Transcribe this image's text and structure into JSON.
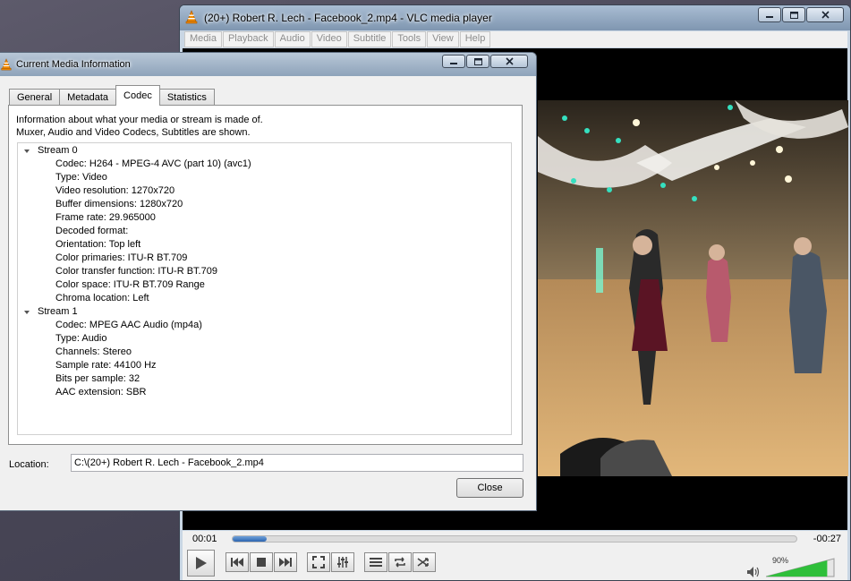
{
  "vlc": {
    "title": "(20+) Robert R. Lech - Facebook_2.mp4 - VLC media player",
    "menu": [
      "Media",
      "Playback",
      "Audio",
      "Video",
      "Subtitle",
      "Tools",
      "View",
      "Help"
    ],
    "time_elapsed": "00:01",
    "time_remaining": "-00:27",
    "seek_progress": 0.06,
    "volume_label": "90%",
    "volume_level": 0.9,
    "buttons": [
      "play",
      "previous",
      "stop",
      "next",
      "fullscreen",
      "extended-settings",
      "playlist",
      "loop",
      "shuffle"
    ]
  },
  "dialog": {
    "title": "Current Media Information",
    "tabs": [
      "General",
      "Metadata",
      "Codec",
      "Statistics"
    ],
    "active_tab": "Codec",
    "intro_lines": [
      "Information about what your media or stream is made of.",
      "Muxer, Audio and Video Codecs, Subtitles are shown."
    ],
    "streams": [
      {
        "name": "Stream 0",
        "properties": [
          "Codec: H264 - MPEG-4 AVC (part 10) (avc1)",
          "Type: Video",
          "Video resolution: 1270x720",
          "Buffer dimensions: 1280x720",
          "Frame rate: 29.965000",
          "Decoded format:",
          "Orientation: Top left",
          "Color primaries: ITU-R BT.709",
          "Color transfer function: ITU-R BT.709",
          "Color space: ITU-R BT.709 Range",
          "Chroma location: Left"
        ]
      },
      {
        "name": "Stream 1",
        "properties": [
          "Codec: MPEG AAC Audio (mp4a)",
          "Type: Audio",
          "Channels: Stereo",
          "Sample rate: 44100 Hz",
          "Bits per sample: 32",
          "AAC extension: SBR"
        ]
      }
    ],
    "location_label": "Location:",
    "location_value": "C:\\(20+) Robert R. Lech - Facebook_2.mp4",
    "close_label": "Close"
  },
  "colors": {
    "vlc_orange": "#f08a00",
    "seek_blue": "#2b64b0",
    "volume_green": "#2fbf3a",
    "titlebar": "#8ea3ba"
  }
}
